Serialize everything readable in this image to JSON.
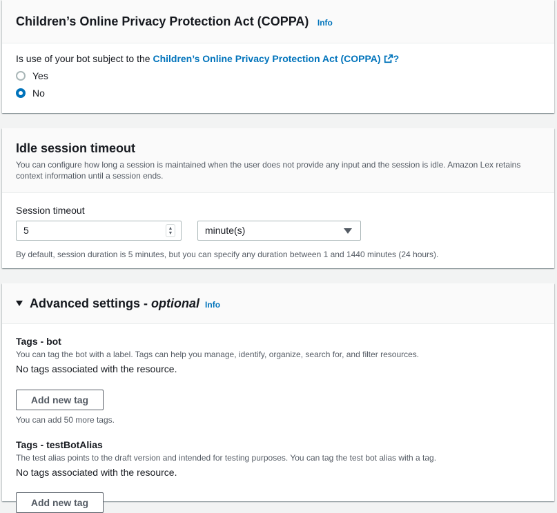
{
  "coppa": {
    "title": "Children’s Online Privacy Protection Act (COPPA)",
    "info": "Info",
    "question_prefix": "Is use of your bot subject to the ",
    "question_link": "Children’s Online Privacy Protection Act (COPPA)",
    "question_suffix": "?",
    "options": [
      {
        "label": "Yes",
        "selected": false
      },
      {
        "label": "No",
        "selected": true
      }
    ]
  },
  "idle": {
    "title": "Idle session timeout",
    "description": "You can configure how long a session is maintained when the user does not provide any input and the session is idle. Amazon Lex retains context information until a session ends.",
    "field_label": "Session timeout",
    "value": "5",
    "unit": "minute(s)",
    "hint": "By default, session duration is 5 minutes, but you can specify any duration between 1 and 1440 minutes (24 hours)."
  },
  "advanced": {
    "title": "Advanced settings - ",
    "title_optional": "optional",
    "info": "Info",
    "tags_bot": {
      "title": "Tags - bot",
      "description": "You can tag the bot with a label. Tags can help you manage, identify, organize, search for, and filter resources.",
      "empty": "No tags associated with the resource.",
      "add_button": "Add new tag",
      "limit": "You can add 50 more tags."
    },
    "tags_alias": {
      "title": "Tags - testBotAlias",
      "description": "The test alias points to the draft version and intended for testing purposes. You can tag the test bot alias with a tag.",
      "empty": "No tags associated with the resource.",
      "add_button": "Add new tag"
    }
  },
  "colors": {
    "link": "#0073bb",
    "text": "#16191f",
    "secondary_text": "#545b64"
  }
}
